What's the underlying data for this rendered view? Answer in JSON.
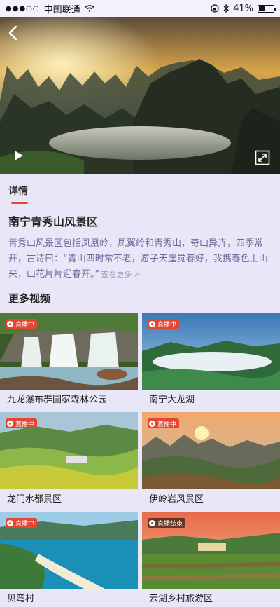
{
  "status_bar": {
    "carrier": "中国联通",
    "battery": "41%",
    "battery_level": 0.41
  },
  "hero": {
    "icons": {
      "back": "back-arrow-icon",
      "play": "play-icon",
      "fullscreen": "fullscreen-icon"
    }
  },
  "details": {
    "tab_label": "详情",
    "title": "南宁青秀山风景区",
    "description": "青秀山风景区包括凤凰岭，凤翼岭和青秀山，奇山异卉，四季常开，古诗曰：“青山四时常不老，游子天崖觉春好，我携春色上山来，山花片片迎春开。”",
    "more": "查看更多 >"
  },
  "more_videos": {
    "title": "更多视频",
    "live_label": "直播中",
    "ended_label": "直播结束",
    "items": [
      {
        "name": "九龙瀑布群国家森林公园",
        "status": "直播中"
      },
      {
        "name": "南宁大龙湖",
        "status": "直播中"
      },
      {
        "name": "龙门水都景区",
        "status": "直播中"
      },
      {
        "name": "伊岭岩风景区",
        "status": "直播中"
      },
      {
        "name": "贝弯村",
        "status": "直播中"
      },
      {
        "name": "云湖乡村旅游区",
        "status": "直播结束"
      }
    ]
  },
  "colors": {
    "background": "#e9e6f7",
    "accent_red": "#e8462e",
    "description_text": "#6b6a9a"
  }
}
